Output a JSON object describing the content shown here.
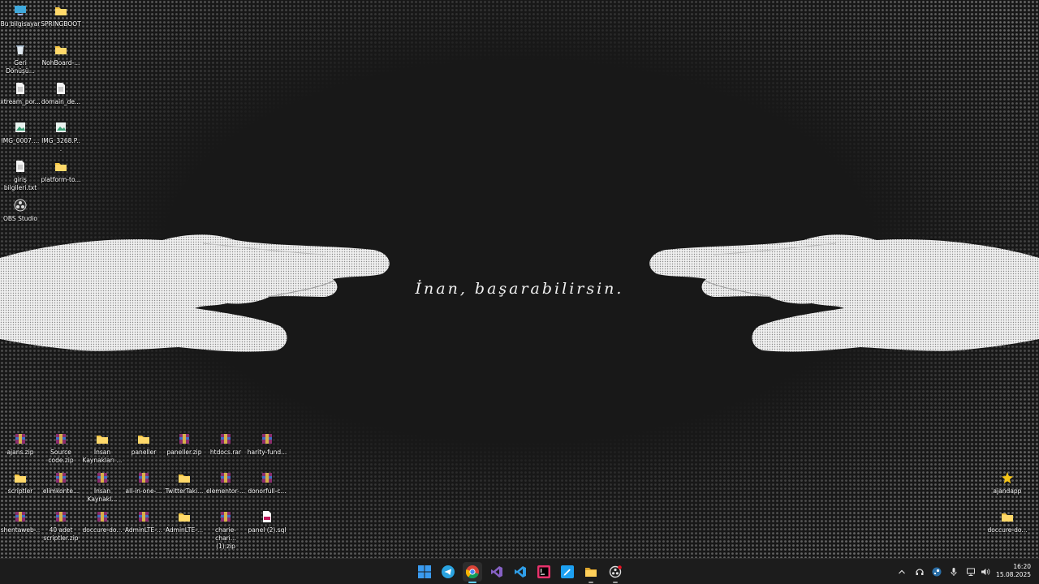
{
  "wallpaper": {
    "quote": "İnan, başarabilirsin."
  },
  "desktop_icons": [
    {
      "label": "Bu bilgisayar",
      "icon": "this-pc-icon"
    },
    {
      "label": "SPRINGBOOT",
      "icon": "folder-icon"
    },
    {
      "label": "Geri Dönüşü...",
      "icon": "recycle-bin-icon"
    },
    {
      "label": "NohBoard-...",
      "icon": "folder-icon"
    },
    {
      "label": "xtream_por...",
      "icon": "text-file-icon"
    },
    {
      "label": "domain_de...",
      "icon": "text-file-icon"
    },
    {
      "label": "IMG_0007....",
      "icon": "image-file-icon"
    },
    {
      "label": "IMG_3268.P...",
      "icon": "image-file-icon"
    },
    {
      "label": "giriş bilgileri.txt",
      "icon": "text-file-icon"
    },
    {
      "label": "platform-to...",
      "icon": "folder-icon"
    },
    {
      "label": "OBS Studio",
      "icon": "obs-icon"
    },
    {
      "label": "ajans.zip",
      "icon": "archive-icon"
    },
    {
      "label": "Source code.zip",
      "icon": "archive-icon"
    },
    {
      "label": "İnsan Kaynakları ...",
      "icon": "folder-icon"
    },
    {
      "label": "paneller",
      "icon": "folder-icon"
    },
    {
      "label": "paneller.zip",
      "icon": "archive-icon"
    },
    {
      "label": "htdocs.rar",
      "icon": "archive-icon"
    },
    {
      "label": "harity-fund...",
      "icon": "archive-icon"
    },
    {
      "label": "scriptler",
      "icon": "folder-icon"
    },
    {
      "label": "elimkonte...",
      "icon": "archive-icon"
    },
    {
      "label": "İnsan Kaynakl...",
      "icon": "archive-icon"
    },
    {
      "label": "all-in-one-...",
      "icon": "archive-icon"
    },
    {
      "label": "TwitterTaki...",
      "icon": "folder-icon"
    },
    {
      "label": "elementor-...",
      "icon": "archive-icon"
    },
    {
      "label": "donorfull-c...",
      "icon": "archive-icon"
    },
    {
      "label": "shentaweb-...",
      "icon": "archive-icon"
    },
    {
      "label": "40 adet scriptler.zip",
      "icon": "archive-icon"
    },
    {
      "label": "doccure-do...",
      "icon": "archive-icon"
    },
    {
      "label": "AdminLTE-...",
      "icon": "archive-icon"
    },
    {
      "label": "AdminLTE-...",
      "icon": "folder-icon"
    },
    {
      "label": "charie-chari... (1).zip",
      "icon": "archive-icon"
    },
    {
      "label": "panel (2).sql",
      "icon": "sql-file-icon"
    },
    {
      "label": "ajandapp",
      "icon": "star-app-icon"
    },
    {
      "label": "doccure-do...",
      "icon": "folder-icon"
    }
  ],
  "taskbar": {
    "apps": [
      "start-icon",
      "telegram-icon",
      "chrome-icon",
      "visual-studio-icon",
      "vscode-icon",
      "intellij-icon",
      "edit-app-icon",
      "file-explorer-icon",
      "obs-recording-icon"
    ],
    "clock": {
      "time": "16:20",
      "date": "15.08.2025"
    }
  },
  "colors": {
    "accent": "#60cdff",
    "folder": "#f4c542",
    "background": "#181818",
    "taskbar": "#1c1c1c"
  }
}
